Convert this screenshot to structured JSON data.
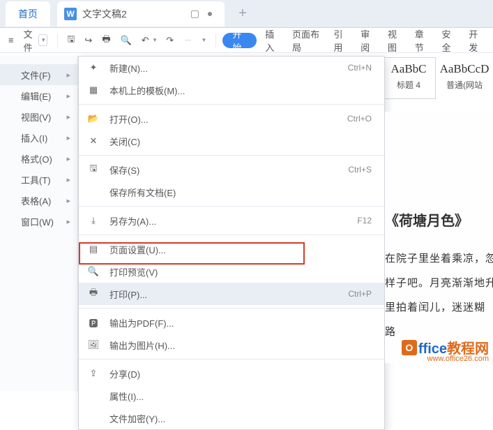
{
  "titlebar": {
    "home": "首页",
    "doc_icon": "W",
    "doc_name": "文字文稿2"
  },
  "toolbar": {
    "file_label": "文件",
    "ribbon": {
      "start": "开始",
      "insert": "插入",
      "page_layout": "页面布局",
      "references": "引用",
      "review": "审阅",
      "view": "视图",
      "chapter": "章节",
      "security": "安全",
      "dev": "开发"
    }
  },
  "styles": {
    "s1_sample": "AaBbC",
    "s1_name": "标题 4",
    "s2_sample": "AaBbCcD",
    "s2_name": "普通(网站"
  },
  "leftmenu": {
    "file": "文件(F)",
    "edit": "编辑(E)",
    "view": "视图(V)",
    "insert": "插入(I)",
    "format": "格式(O)",
    "tools": "工具(T)",
    "table": "表格(A)",
    "window": "窗口(W)"
  },
  "dropdown": {
    "new": "新建(N)...",
    "templates": "本机上的模板(M)...",
    "open": "打开(O)...",
    "close": "关闭(C)",
    "save": "保存(S)",
    "save_all": "保存所有文档(E)",
    "save_as": "另存为(A)...",
    "page_setup": "页面设置(U)...",
    "print_preview": "打印预览(V)",
    "print": "打印(P)...",
    "export_pdf": "输出为PDF(F)...",
    "export_img": "输出为图片(H)...",
    "share": "分享(D)",
    "properties": "属性(I)...",
    "encrypt": "文件加密(Y)...",
    "sc_new": "Ctrl+N",
    "sc_open": "Ctrl+O",
    "sc_save": "Ctrl+S",
    "sc_saveas": "F12",
    "sc_print": "Ctrl+P"
  },
  "document": {
    "title": "《荷塘月色》",
    "line1": "在院子里坐着乘凉，忽",
    "line2": "样子吧。月亮渐渐地升",
    "line3": "里拍着闰儿，迷迷糊",
    "line4": "路"
  },
  "watermark": {
    "badge": "O",
    "t1": "ffice",
    "t2": "教程网",
    "sub": "www.office26.com"
  }
}
